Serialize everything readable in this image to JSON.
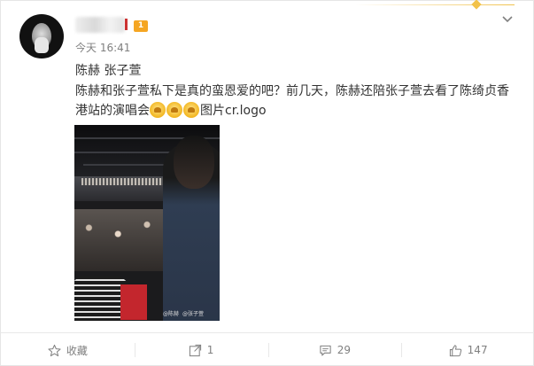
{
  "post": {
    "time": "今天 16:41",
    "vip_badge": "1",
    "title": "陈赫 张子萱",
    "text_part1": "陈赫和张子萱私下是真的蛮恩爱的吧？前几天，陈赫还陪张子萱去看了陈绮贞香港站的演唱会",
    "emoji_count": 3,
    "emoji_name": "cheer-emoji",
    "pic_link": "图片cr.logo",
    "image": {
      "watermark_left": "@陈赫",
      "watermark_right": "@张子萱"
    }
  },
  "actions": {
    "favorite_label": "收藏",
    "repost_count": "1",
    "comment_count": "29",
    "like_count": "147"
  },
  "icons": {
    "favorite": "star-icon",
    "repost": "share-icon",
    "comment": "comment-icon",
    "like": "thumbs-up-icon",
    "more": "chevron-down-icon"
  },
  "colors": {
    "text": "#333333",
    "muted": "#808080",
    "badge": "#f5a623",
    "accent_gold": "#f0c24e"
  }
}
